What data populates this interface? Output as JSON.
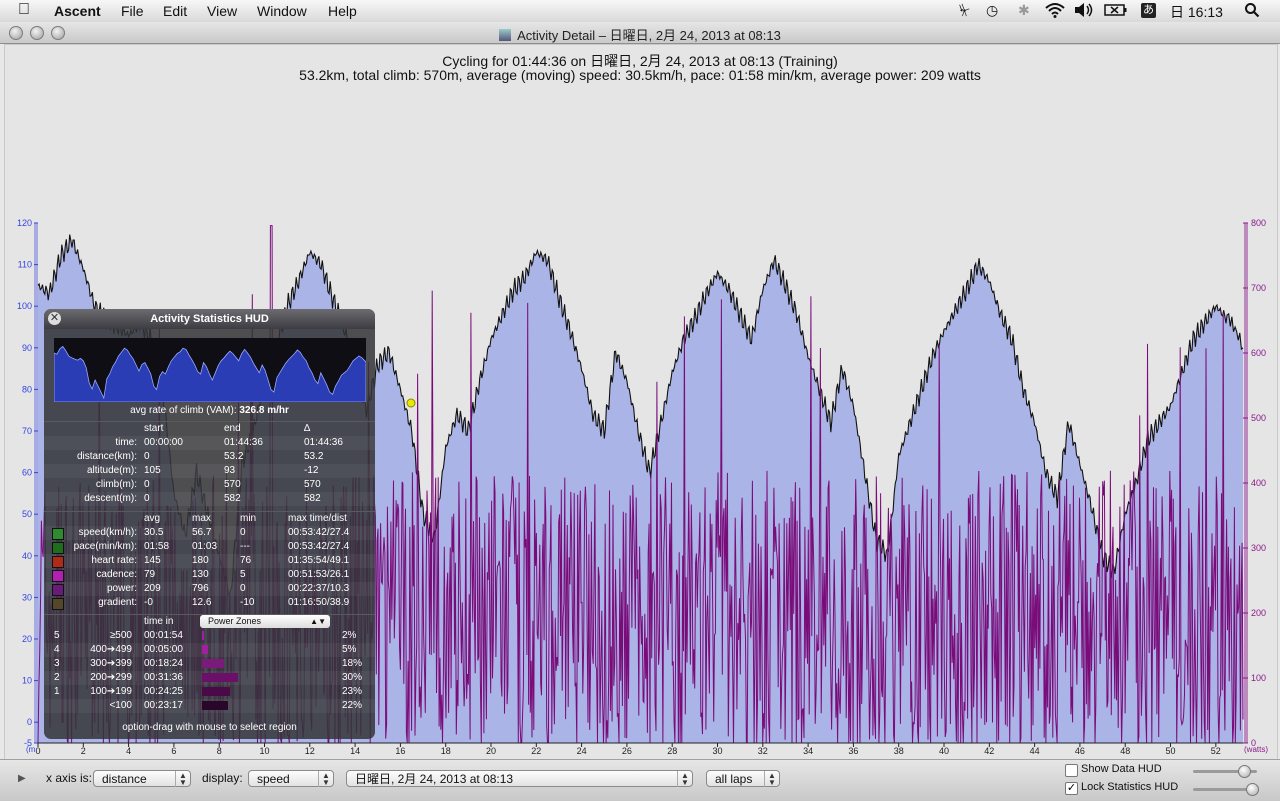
{
  "menubar": {
    "apple": "",
    "app_name": "Ascent",
    "menus": [
      "File",
      "Edit",
      "View",
      "Window",
      "Help"
    ],
    "clock": "日 16:13",
    "input_method": "あ",
    "status_icons": [
      "eject-icon",
      "time-machine-icon",
      "bluetooth-icon",
      "wifi-icon",
      "volume-icon",
      "battery-icon",
      "spotlight-icon"
    ]
  },
  "window": {
    "title": "Activity Detail – 日曜日, 2月 24, 2013 at 08:13"
  },
  "header": {
    "line1": "Cycling for 01:44:36 on 日曜日, 2月 24, 2013 at 08:13 (Training)",
    "line2": "53.2km, total climb: 570m, average (moving) speed: 30.5km/h, pace: 01:58 min/km, average power: 209 watts"
  },
  "chart_data": {
    "type": "area",
    "x_label": "(m",
    "x_ticks": [
      "0",
      "2",
      "4",
      "6",
      "8",
      "10",
      "12",
      "14",
      "16",
      "18",
      "20",
      "22",
      "24",
      "26",
      "28",
      "30",
      "32",
      "34",
      "36",
      "38",
      "40",
      "42",
      "44",
      "46",
      "48",
      "50",
      "52"
    ],
    "y_left_ticks": [
      "120",
      "110",
      "100",
      "90",
      "80",
      "70",
      "60",
      "50",
      "40",
      "30",
      "20",
      "10",
      "0",
      "-5"
    ],
    "y_left_range": [
      -5,
      120
    ],
    "y_right_label": "(watts)",
    "y_right_ticks": [
      "800",
      "700",
      "600",
      "500",
      "400",
      "300",
      "200",
      "100",
      "0"
    ],
    "y_right_range": [
      0,
      800
    ],
    "x_range": [
      0,
      53.2
    ],
    "colors": {
      "speed_fill": "#aab4e6",
      "speed_line": "#111111",
      "power_line": "#7a0c7a",
      "left_axis": "#3344dd",
      "right_axis": "#8a1a8a"
    },
    "series": [
      {
        "name": "speed",
        "x": [
          0,
          0.5,
          1.0,
          1.5,
          2.0,
          2.5,
          3.0,
          3.5,
          4.0,
          4.5,
          5.0,
          5.5,
          6.0,
          6.5,
          7.0,
          7.5,
          8.0,
          8.5,
          9.0,
          9.5,
          10.0,
          10.5,
          11.0,
          11.5,
          12.0,
          12.5,
          13.0,
          13.5,
          14.0,
          14.5,
          15.0,
          15.5,
          16.0,
          16.5,
          17.0,
          17.5,
          18.0,
          18.5,
          19.0,
          19.5,
          20.0,
          20.5,
          21.0,
          21.5,
          22.0,
          22.5,
          23.0,
          23.5,
          24.0,
          24.5,
          25.0,
          25.5,
          26.0,
          26.5,
          27.0,
          27.5,
          28.0,
          28.5,
          29.0,
          29.5,
          30.0,
          30.5,
          31.0,
          31.5,
          32.0,
          32.5,
          33.0,
          33.5,
          34.0,
          34.5,
          35.0,
          35.5,
          36.0,
          36.5,
          37.0,
          37.5,
          38.0,
          38.5,
          39.0,
          39.5,
          40.0,
          40.5,
          41.0,
          41.5,
          42.0,
          42.5,
          43.0,
          43.5,
          44.0,
          44.5,
          45.0,
          45.5,
          46.0,
          46.5,
          47.0,
          47.5,
          48.0,
          48.5,
          49.0,
          49.5,
          50.0,
          50.5,
          51.0,
          51.5,
          52.0,
          52.5,
          53.2
        ],
        "values": [
          105,
          103,
          112,
          116,
          109,
          100,
          97,
          95,
          93,
          96,
          92,
          80,
          55,
          45,
          60,
          50,
          40,
          30,
          62,
          70,
          82,
          90,
          100,
          106,
          113,
          110,
          102,
          95,
          85,
          75,
          86,
          89,
          80,
          70,
          50,
          44,
          66,
          74,
          70,
          82,
          92,
          98,
          104,
          107,
          113,
          111,
          102,
          94,
          85,
          74,
          70,
          89,
          82,
          70,
          60,
          72,
          84,
          92,
          97,
          103,
          108,
          104,
          98,
          92,
          104,
          111,
          105,
          98,
          88,
          80,
          72,
          85,
          76,
          60,
          44,
          40,
          64,
          72,
          80,
          88,
          94,
          99,
          104,
          110,
          106,
          98,
          92,
          80,
          72,
          60,
          54,
          72,
          62,
          52,
          40,
          36,
          50,
          58,
          68,
          72,
          76,
          84,
          92,
          96,
          100,
          97,
          90
        ]
      },
      {
        "name": "power",
        "x_range": [
          0,
          53.2
        ],
        "mean": 209,
        "max": 796
      }
    ]
  },
  "hud": {
    "title": "Activity Statistics HUD",
    "vam_label": "avg rate of climb (VAM):",
    "vam_value": "326.8 m/hr",
    "summary_headers": [
      "start",
      "end",
      "∆"
    ],
    "summary_rows": [
      {
        "label": "time:",
        "start": "00:00:00",
        "end": "01:44:36",
        "delta": "01:44:36"
      },
      {
        "label": "distance(km):",
        "start": "0",
        "end": "53.2",
        "delta": "53.2"
      },
      {
        "label": "altitude(m):",
        "start": "105",
        "end": "93",
        "delta": "-12"
      },
      {
        "label": "climb(m):",
        "start": "0",
        "end": "570",
        "delta": "570"
      },
      {
        "label": "descent(m):",
        "start": "0",
        "end": "582",
        "delta": "582"
      }
    ],
    "metric_headers": [
      "avg",
      "max",
      "min",
      "max time/dist"
    ],
    "metric_rows": [
      {
        "color": "#2e8b2e",
        "label": "speed(km/h):",
        "avg": "30.5",
        "max": "56.7",
        "min": "0",
        "maxat": "00:53:42/27.4"
      },
      {
        "color": "#1f6e1f",
        "label": "pace(min/km):",
        "avg": "01:58",
        "max": "01:03",
        "min": "---",
        "maxat": "00:53:42/27.4"
      },
      {
        "color": "#b02a1a",
        "label": "heart rate:",
        "avg": "145",
        "max": "180",
        "min": "76",
        "maxat": "01:35:54/49.1"
      },
      {
        "color": "#b21fb2",
        "label": "cadence:",
        "avg": "79",
        "max": "130",
        "min": "5",
        "maxat": "00:51:53/26.1"
      },
      {
        "color": "#6a1a7a",
        "label": "power:",
        "avg": "209",
        "max": "796",
        "min": "0",
        "maxat": "00:22:37/10.3"
      },
      {
        "color": "#55482a",
        "label": "gradient:",
        "avg": "-0",
        "max": "12.6",
        "min": "-10",
        "maxat": "01:16:50/38.9"
      }
    ],
    "zones_header": "time in",
    "zones_select": "Power Zones",
    "zones": [
      {
        "num": "5",
        "range": "≥500",
        "time": "00:01:54",
        "pct": "2%",
        "frac": 0.02
      },
      {
        "num": "4",
        "range": "400➔499",
        "time": "00:05:00",
        "pct": "5%",
        "frac": 0.05
      },
      {
        "num": "3",
        "range": "300➔399",
        "time": "00:18:24",
        "pct": "18%",
        "frac": 0.18
      },
      {
        "num": "2",
        "range": "200➔299",
        "time": "00:31:36",
        "pct": "30%",
        "frac": 0.3
      },
      {
        "num": "1",
        "range": "100➔199",
        "time": "00:24:25",
        "pct": "23%",
        "frac": 0.23
      },
      {
        "num": "",
        "range": "<100",
        "time": "00:23:17",
        "pct": "22%",
        "frac": 0.22
      }
    ],
    "footer": "option-drag with mouse to select region"
  },
  "toolbar": {
    "x_axis_label": "x axis is:",
    "x_axis_value": "distance",
    "display_label": "display:",
    "display_value": "speed",
    "activity_value": "日曜日, 2月 24, 2013 at 08:13",
    "laps_value": "all laps",
    "show_data_hud": "Show Data HUD",
    "lock_stats_hud": "Lock Statistics HUD",
    "show_data_checked": false,
    "lock_stats_checked": true
  }
}
